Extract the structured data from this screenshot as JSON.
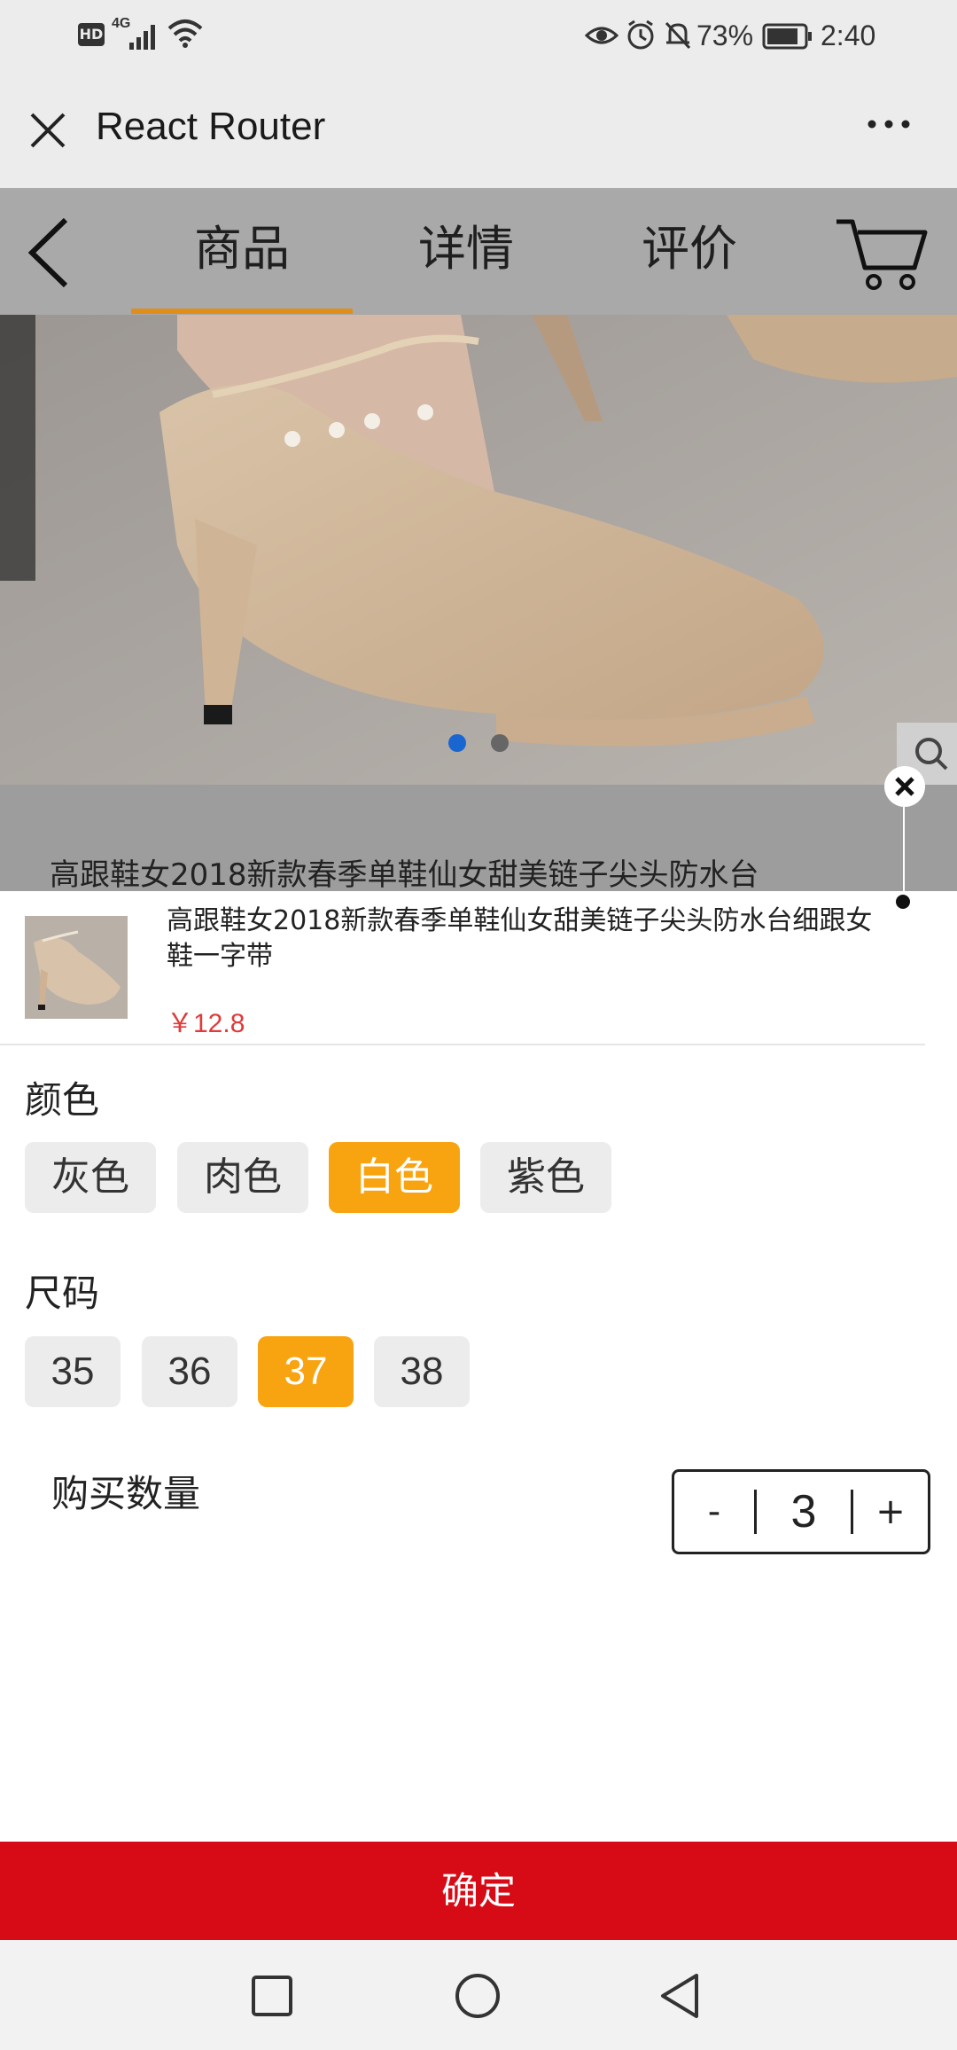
{
  "status_bar": {
    "left_icons": [
      "hd-icon",
      "4g-signal-icon",
      "wifi-icon"
    ],
    "network_label": "HD",
    "network_type": "4G",
    "battery": "73%",
    "time": "2:40"
  },
  "titlebar": {
    "title": "React Router",
    "more_label": "···"
  },
  "product_nav": {
    "tabs": [
      {
        "label": "商品",
        "active": true
      },
      {
        "label": "详情",
        "active": false
      },
      {
        "label": "评价",
        "active": false
      }
    ],
    "accent": "#e08e1a"
  },
  "carousel": {
    "slides": 2,
    "active_index": 0
  },
  "background_title": "高跟鞋女2018新款春季单鞋仙女甜美链子尖头防水台",
  "product": {
    "title": "高跟鞋女2018新款春季单鞋仙女甜美链子尖头防水台细跟女鞋一字带",
    "price": "￥12.8",
    "price_color": "#e03a3a"
  },
  "color_section": {
    "label": "颜色",
    "options": [
      "灰色",
      "肉色",
      "白色",
      "紫色"
    ],
    "selected": "白色"
  },
  "size_section": {
    "label": "尺码",
    "options": [
      "35",
      "36",
      "37",
      "38"
    ],
    "selected": "37"
  },
  "quantity": {
    "label": "购买数量",
    "minus": "-",
    "value": "3",
    "plus": "+"
  },
  "confirm": {
    "label": "确定",
    "color": "#d60b16"
  },
  "selected_color": "#f8a411"
}
